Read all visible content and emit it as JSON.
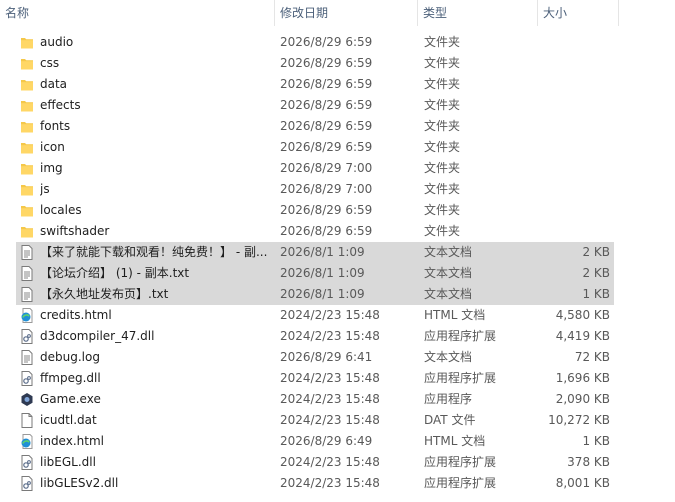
{
  "header": {
    "name": "名称",
    "date": "修改日期",
    "type": "类型",
    "size": "大小",
    "sort_indicator": "^"
  },
  "colors": {
    "folder": "#f5c84a",
    "selected_row": "#d9d9d9",
    "header_text": "#4c607a"
  },
  "rows": [
    {
      "name": "audio",
      "date": "2026/8/29 6:59",
      "type": "文件夹",
      "size": "",
      "icon": "folder-icon",
      "selected": false
    },
    {
      "name": "css",
      "date": "2026/8/29 6:59",
      "type": "文件夹",
      "size": "",
      "icon": "folder-icon",
      "selected": false
    },
    {
      "name": "data",
      "date": "2026/8/29 6:59",
      "type": "文件夹",
      "size": "",
      "icon": "folder-icon",
      "selected": false
    },
    {
      "name": "effects",
      "date": "2026/8/29 6:59",
      "type": "文件夹",
      "size": "",
      "icon": "folder-icon",
      "selected": false
    },
    {
      "name": "fonts",
      "date": "2026/8/29 6:59",
      "type": "文件夹",
      "size": "",
      "icon": "folder-icon",
      "selected": false
    },
    {
      "name": "icon",
      "date": "2026/8/29 6:59",
      "type": "文件夹",
      "size": "",
      "icon": "folder-icon",
      "selected": false
    },
    {
      "name": "img",
      "date": "2026/8/29 7:00",
      "type": "文件夹",
      "size": "",
      "icon": "folder-icon",
      "selected": false
    },
    {
      "name": "js",
      "date": "2026/8/29 7:00",
      "type": "文件夹",
      "size": "",
      "icon": "folder-icon",
      "selected": false
    },
    {
      "name": "locales",
      "date": "2026/8/29 6:59",
      "type": "文件夹",
      "size": "",
      "icon": "folder-icon",
      "selected": false
    },
    {
      "name": "swiftshader",
      "date": "2026/8/29 6:59",
      "type": "文件夹",
      "size": "",
      "icon": "folder-icon",
      "selected": false
    },
    {
      "name": "【来了就能下载和观看！纯免费！】 - 副...",
      "date": "2026/8/1 1:09",
      "type": "文本文档",
      "size": "2 KB",
      "icon": "text-file-icon",
      "selected": true
    },
    {
      "name": "【论坛介绍】 (1) - 副本.txt",
      "date": "2026/8/1 1:09",
      "type": "文本文档",
      "size": "2 KB",
      "icon": "text-file-icon",
      "selected": true
    },
    {
      "name": "【永久地址发布页】.txt",
      "date": "2026/8/1 1:09",
      "type": "文本文档",
      "size": "1 KB",
      "icon": "text-file-icon",
      "selected": true
    },
    {
      "name": "credits.html",
      "date": "2024/2/23 15:48",
      "type": "HTML 文档",
      "size": "4,580 KB",
      "icon": "edge-html-icon",
      "selected": false
    },
    {
      "name": "d3dcompiler_47.dll",
      "date": "2024/2/23 15:48",
      "type": "应用程序扩展",
      "size": "4,419 KB",
      "icon": "dll-file-icon",
      "selected": false
    },
    {
      "name": "debug.log",
      "date": "2026/8/29 6:41",
      "type": "文本文档",
      "size": "72 KB",
      "icon": "text-file-icon",
      "selected": false
    },
    {
      "name": "ffmpeg.dll",
      "date": "2024/2/23 15:48",
      "type": "应用程序扩展",
      "size": "1,696 KB",
      "icon": "dll-file-icon",
      "selected": false
    },
    {
      "name": "Game.exe",
      "date": "2024/2/23 15:48",
      "type": "应用程序",
      "size": "2,090 KB",
      "icon": "game-exe-icon",
      "selected": false
    },
    {
      "name": "icudtl.dat",
      "date": "2024/2/23 15:48",
      "type": "DAT 文件",
      "size": "10,272 KB",
      "icon": "blank-file-icon",
      "selected": false
    },
    {
      "name": "index.html",
      "date": "2026/8/29 6:49",
      "type": "HTML 文档",
      "size": "1 KB",
      "icon": "edge-html-icon",
      "selected": false
    },
    {
      "name": "libEGL.dll",
      "date": "2024/2/23 15:48",
      "type": "应用程序扩展",
      "size": "378 KB",
      "icon": "dll-file-icon",
      "selected": false
    },
    {
      "name": "libGLESv2.dll",
      "date": "2024/2/23 15:48",
      "type": "应用程序扩展",
      "size": "8,001 KB",
      "icon": "dll-file-icon",
      "selected": false
    }
  ]
}
